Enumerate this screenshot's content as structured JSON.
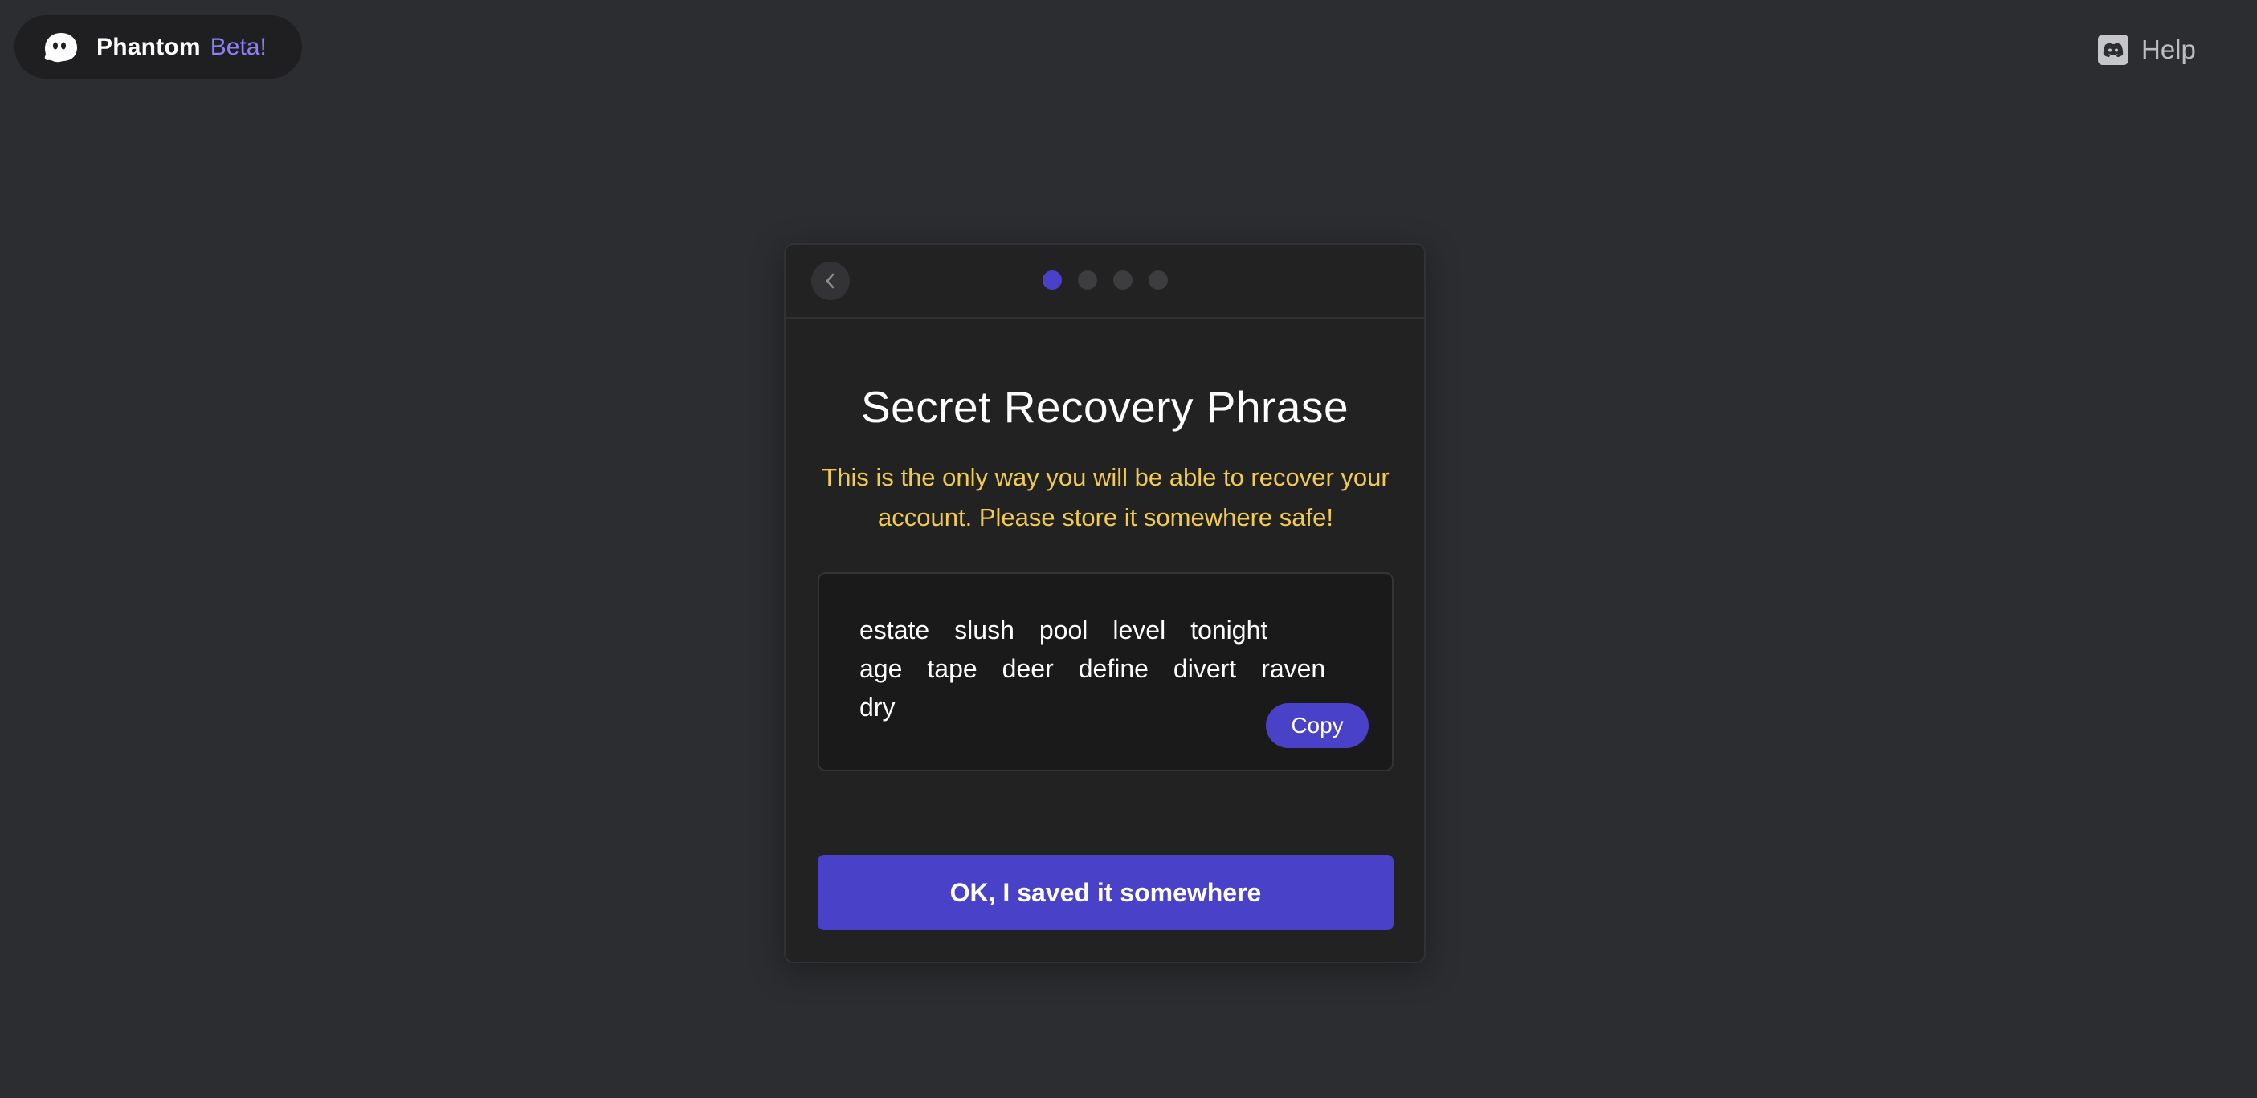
{
  "brand": {
    "name": "Phantom",
    "badge": "Beta!",
    "logo_icon": "ghost-icon",
    "badge_color": "#8a81f8"
  },
  "help": {
    "label": "Help",
    "icon": "discord-icon"
  },
  "onboarding": {
    "back_icon": "chevron-left-icon",
    "steps_total": 4,
    "current_step": 1,
    "title": "Secret Recovery Phrase",
    "warning": "This is the only way you will be able to recover your account. Please store it somewhere safe!",
    "phrase_lines": [
      [
        "estate",
        "slush",
        "pool",
        "level",
        "tonight"
      ],
      [
        "age",
        "tape",
        "deer",
        "define",
        "divert",
        "raven"
      ],
      [
        "dry"
      ]
    ],
    "copy_label": "Copy",
    "confirm_label": "OK, I saved it somewhere"
  },
  "colors": {
    "background": "#2c2d30",
    "card": "#222222",
    "accent": "#4a41c9",
    "warning": "#f1cb4f"
  }
}
